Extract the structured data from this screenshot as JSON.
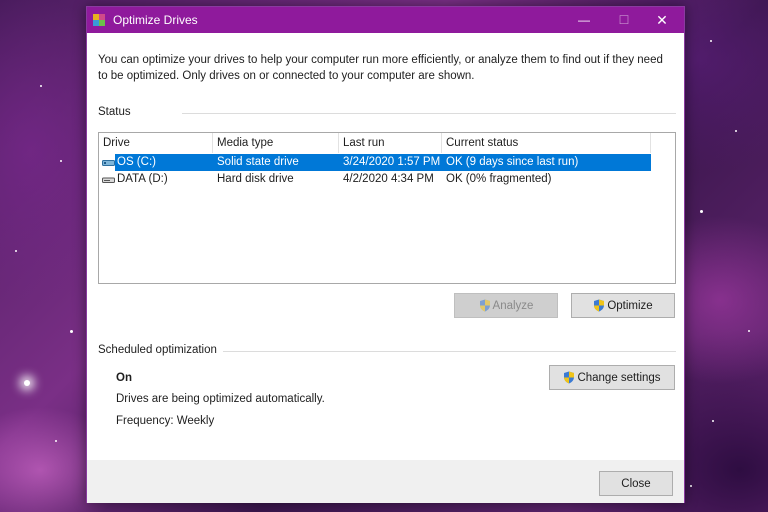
{
  "window": {
    "title": "Optimize Drives",
    "controls": {
      "minimize": "—",
      "maximize": "☐",
      "close": "✕"
    }
  },
  "description": "You can optimize your drives to help your computer run more efficiently, or analyze them to find out if they need to be optimized. Only drives on or connected to your computer are shown.",
  "status": {
    "label": "Status",
    "columns": [
      "Drive",
      "Media type",
      "Last run",
      "Current status"
    ],
    "drives": [
      {
        "drive": "OS (C:)",
        "media_type": "Solid state drive",
        "last_run": "3/24/2020 1:57 PM",
        "current_status": "OK (9 days since last run)",
        "selected": true
      },
      {
        "drive": "DATA (D:)",
        "media_type": "Hard disk drive",
        "last_run": "4/2/2020 4:34 PM",
        "current_status": "OK (0% fragmented)",
        "selected": false
      }
    ],
    "analyze_label": "Analyze",
    "optimize_label": "Optimize"
  },
  "scheduled": {
    "label": "Scheduled optimization",
    "state": "On",
    "message": "Drives are being optimized automatically.",
    "frequency": "Frequency: Weekly",
    "change_settings_label": "Change settings"
  },
  "footer": {
    "close_label": "Close"
  },
  "colors": {
    "titlebar": "#8f1a9c",
    "selection": "#0078d7"
  }
}
